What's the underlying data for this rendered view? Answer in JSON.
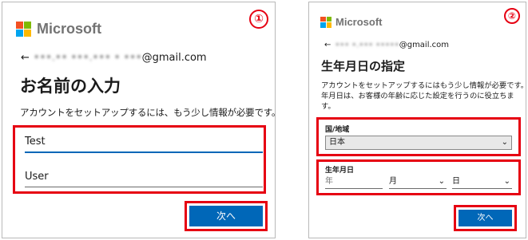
{
  "step1": {
    "badge": "①",
    "brand": "Microsoft",
    "email_masked": "•••.•• •••.••• • •••",
    "email_domain": "@gmail.com",
    "title": "お名前の入力",
    "description": "アカウントをセットアップするには、もう少し情報が必要です。",
    "first_name_value": "Test",
    "last_name_value": "User",
    "next_label": "次へ"
  },
  "step2": {
    "badge": "②",
    "brand": "Microsoft",
    "email_masked": "••• •.••• •••••",
    "email_domain": "@gmail.com",
    "title": "生年月日の指定",
    "description_lines": [
      "アカウントをセットアップするにはもう少し情報が必要です。生",
      "年月日は、お客様の年齢に応じた設定を行うのに役立ちま",
      "す。"
    ],
    "country_label": "国/地域",
    "country_value": "日本",
    "birthdate_label": "生年月日",
    "year_placeholder": "年",
    "month_placeholder": "月",
    "day_placeholder": "日",
    "next_label": "次へ"
  },
  "colors": {
    "accent_blue": "#0067b8",
    "highlight_red": "#e60012",
    "ms_red": "#f25022",
    "ms_green": "#7fba00",
    "ms_blue": "#00a4ef",
    "ms_yellow": "#ffb900"
  },
  "icons": [
    "back-arrow-icon",
    "chevron-down-icon",
    "microsoft-logo-icon"
  ]
}
